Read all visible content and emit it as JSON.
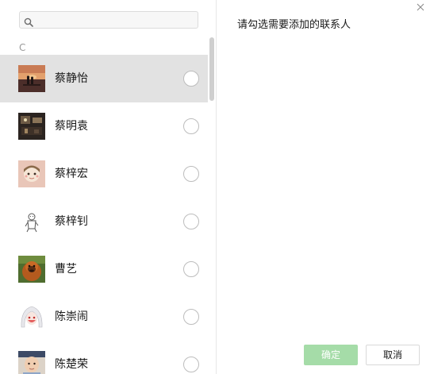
{
  "search": {
    "value": "",
    "placeholder": ""
  },
  "section": {
    "letter": "C"
  },
  "contacts": [
    {
      "name": "蔡静怡",
      "avatar": "sunset-couple-photo-avatar",
      "selected": true,
      "checked": false
    },
    {
      "name": "蔡明袁",
      "avatar": "dark-room-photo-avatar",
      "selected": false,
      "checked": false
    },
    {
      "name": "蔡梓宏",
      "avatar": "anime-girl-avatar",
      "selected": false,
      "checked": false
    },
    {
      "name": "蔡梓钊",
      "avatar": "sketch-figure-avatar",
      "selected": false,
      "checked": false
    },
    {
      "name": "曹艺",
      "avatar": "orangutan-avatar",
      "selected": false,
      "checked": false
    },
    {
      "name": "陈崇闹",
      "avatar": "anime-white-hair-avatar",
      "selected": false,
      "checked": false
    },
    {
      "name": "陈楚荣",
      "avatar": "baby-photo-avatar",
      "selected": false,
      "checked": false
    }
  ],
  "right_panel": {
    "prompt": "请勾选需要添加的联系人"
  },
  "buttons": {
    "confirm": "确定",
    "cancel": "取消"
  },
  "icons": {
    "close": "close-icon",
    "search": "search-icon"
  },
  "colors": {
    "confirm_button_bg": "#a5dca8",
    "selected_row_bg": "#e2e2e2",
    "divider": "#e7e7e7"
  }
}
